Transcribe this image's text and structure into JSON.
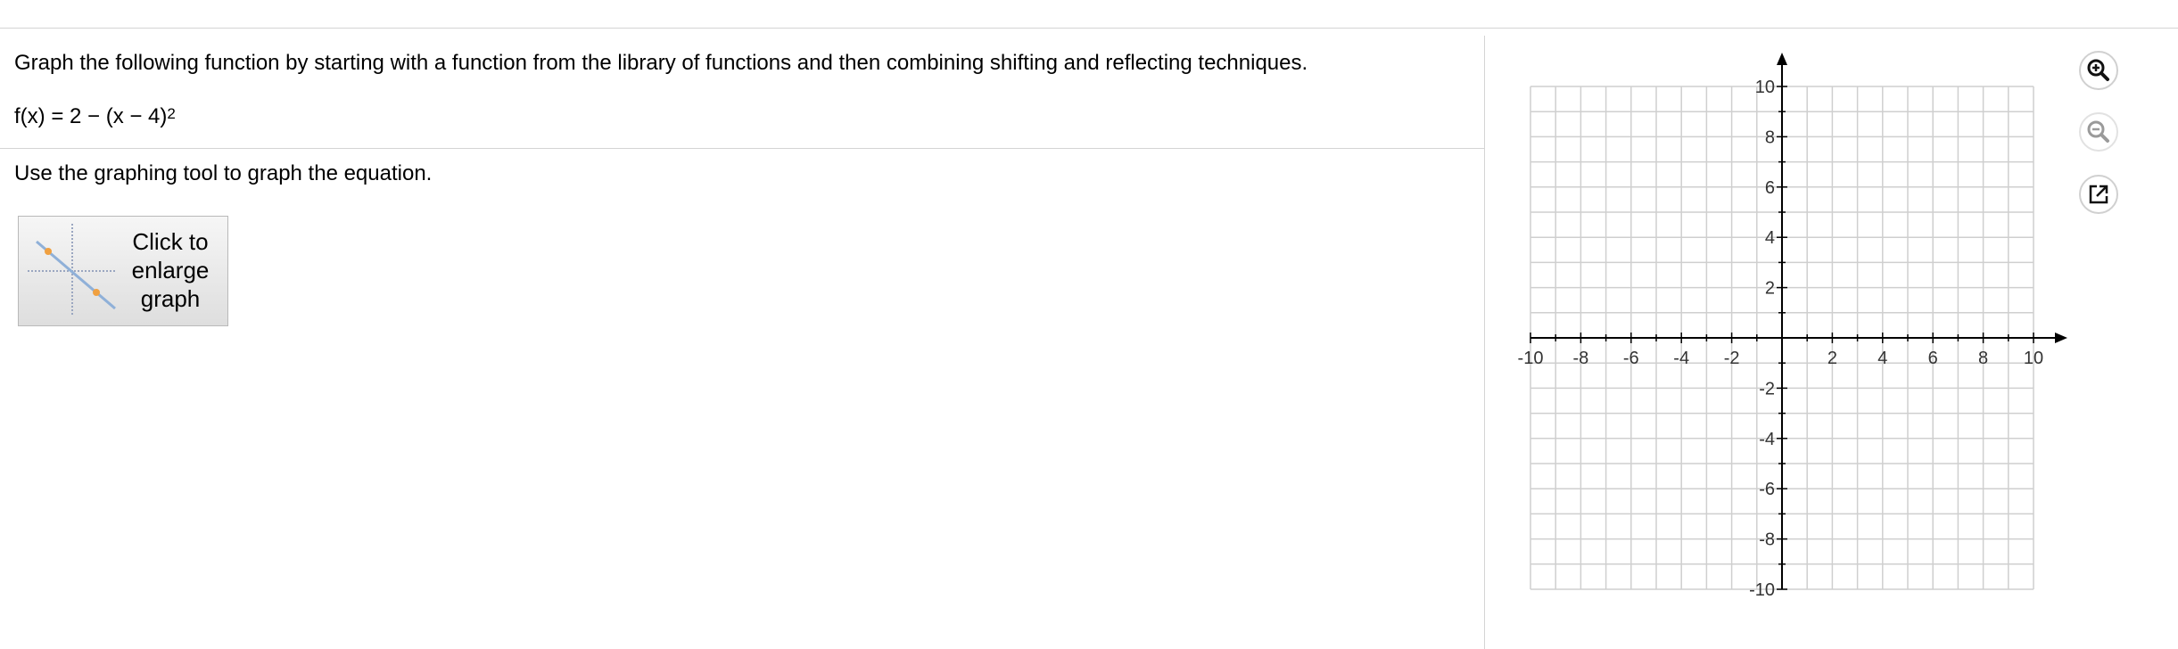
{
  "question": {
    "prompt": "Graph the following function by starting with a function from the library of functions and then combining shifting and reflecting techniques.",
    "function_text": "f(x) = 2 − (x − 4)",
    "function_exponent": "2"
  },
  "answer": {
    "instruction": "Use the graphing tool to graph the equation.",
    "enlarge_button_label": "Click to enlarge graph"
  },
  "graph": {
    "x_range": [
      -10,
      10
    ],
    "y_range": [
      -10,
      10
    ],
    "minor_step": 1,
    "tick_label_step": 2,
    "x_tick_labels": [
      "-10",
      "-8",
      "-6",
      "-4",
      "-2",
      "2",
      "4",
      "6",
      "8",
      "10"
    ],
    "y_tick_labels": [
      "10",
      "8",
      "6",
      "4",
      "2",
      "-2",
      "-4",
      "-6",
      "-8",
      "-10"
    ],
    "grid_color": "#cfcfcf",
    "axis_color": "#000000"
  },
  "tools": {
    "zoom_in_icon": "magnifier-plus-icon",
    "zoom_out_icon": "magnifier-minus-icon",
    "popout_icon": "popout-arrow-icon"
  }
}
